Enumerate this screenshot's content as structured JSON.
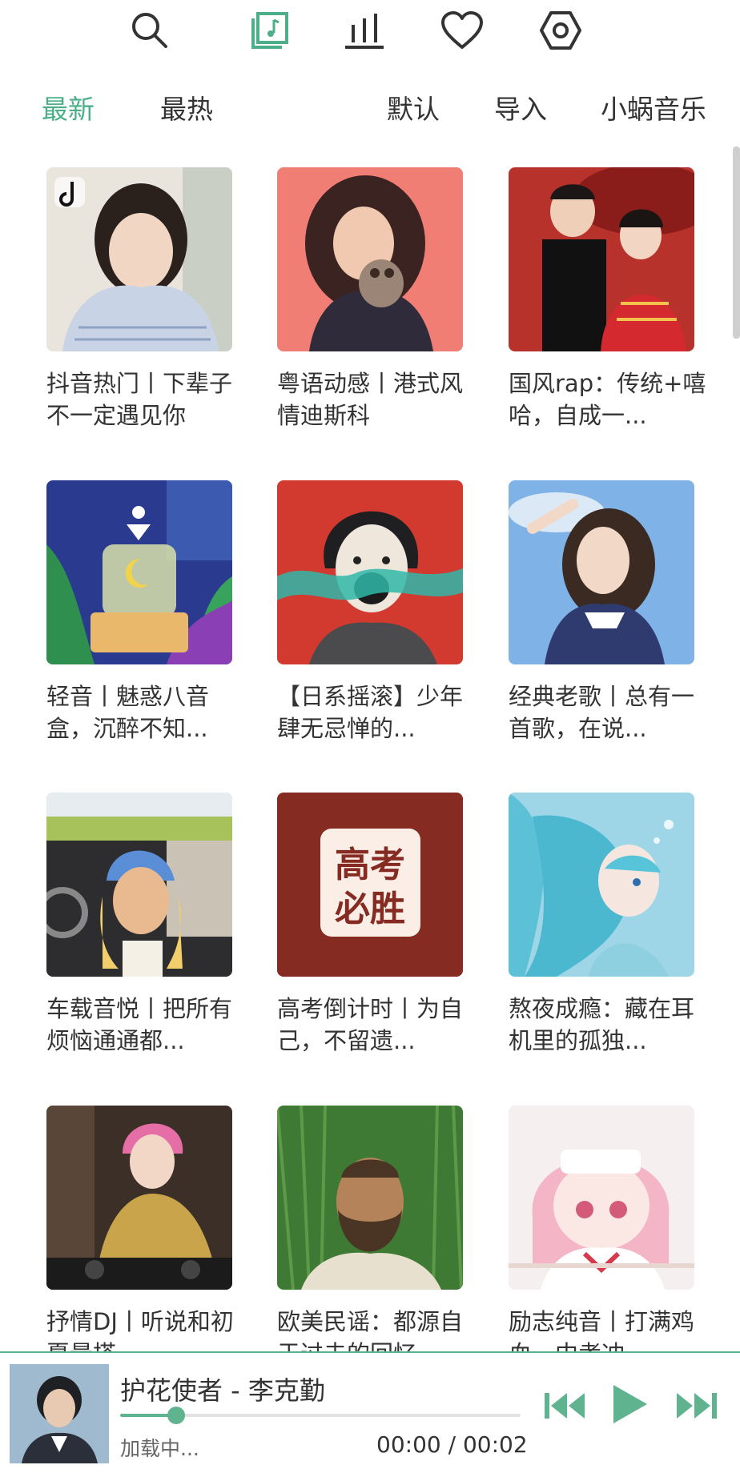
{
  "top_nav": {
    "icons": [
      "search-icon",
      "music-note-icon",
      "bar-chart-icon",
      "heart-icon",
      "hexagon-settings-icon"
    ],
    "active_color": "#4caf8a",
    "icon_color": "#333333"
  },
  "tabs": {
    "items": [
      "最新",
      "最热",
      "默认",
      "导入",
      "小蜗音乐"
    ],
    "active_index": 0
  },
  "playlists": [
    {
      "title": "抖音热门丨下辈子不一定遇见你",
      "cover": "cover-portrait-girl-stripes"
    },
    {
      "title": "粤语动感丨港式风情迪斯科",
      "cover": "cover-woman-pink-bg"
    },
    {
      "title": "国风rap：传统+嘻哈，自成一...",
      "cover": "cover-couple-red-umbrella"
    },
    {
      "title": "轻音丨魅惑八音盒，沉醉不知...",
      "cover": "cover-music-box-illustration"
    },
    {
      "title": "【日系摇滚】少年肆无忌惮的...",
      "cover": "cover-anime-boy-red"
    },
    {
      "title": "经典老歌丨总有一首歌，在说...",
      "cover": "cover-girl-sky"
    },
    {
      "title": "车载音悦丨把所有烦恼通通都...",
      "cover": "cover-girl-car"
    },
    {
      "title": "高考倒计时丨为自己，不留遗...",
      "cover": "cover-gaokao",
      "cover_text": [
        "高考",
        "必胜"
      ]
    },
    {
      "title": "熬夜成瘾：藏在耳机里的孤独...",
      "cover": "cover-anime-girl-blue"
    },
    {
      "title": "抒情DJ丨听说和初夏最搭",
      "cover": "cover-dj-girl"
    },
    {
      "title": "欧美民谣：都源自于过去的回忆",
      "cover": "cover-bearded-man-grass"
    },
    {
      "title": "励志纯音丨打满鸡血，中考冲...",
      "cover": "cover-anime-pink-hair"
    }
  ],
  "player": {
    "song": "护花使者 - 李克勤",
    "status": "加载中...",
    "current_time": "00:00",
    "separator": " / ",
    "total_time": "00:02",
    "progress": 0.14,
    "accent": "#5fb38f",
    "controls": [
      "previous-icon",
      "play-icon",
      "next-icon"
    ]
  }
}
